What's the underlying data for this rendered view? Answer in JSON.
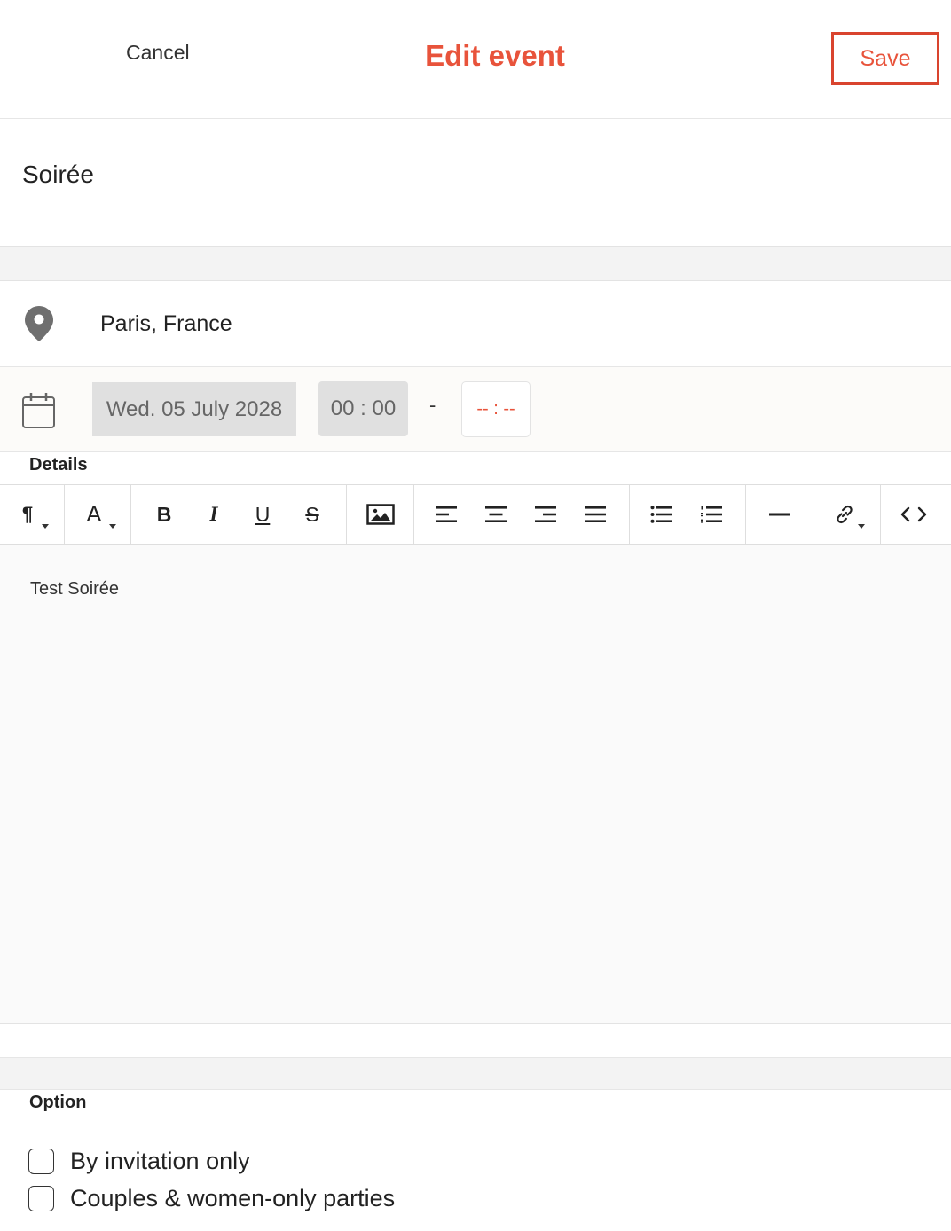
{
  "header": {
    "cancel_label": "Cancel",
    "title": "Edit event",
    "save_label": "Save"
  },
  "event": {
    "name": "Soirée",
    "location": "Paris, France",
    "date": "Wed. 05 July 2028",
    "start_time": "00 : 00",
    "separator": "-",
    "end_time": "-- : --"
  },
  "details": {
    "label": "Details",
    "content": "Test Soirée"
  },
  "toolbar": {
    "paragraph_glyph": "¶",
    "font_glyph": "A",
    "bold_glyph": "B",
    "italic_glyph": "I",
    "underline_glyph": "U",
    "strike_glyph": "S"
  },
  "options": {
    "label": "Option",
    "items": [
      {
        "label": "By invitation only",
        "checked": false
      },
      {
        "label": "Couples & women-only parties",
        "checked": false
      }
    ]
  },
  "colors": {
    "accent": "#e8533b",
    "save_border": "#d9442e",
    "muted_field": "#e0e0e0",
    "section_gap": "#f3f3f3"
  }
}
